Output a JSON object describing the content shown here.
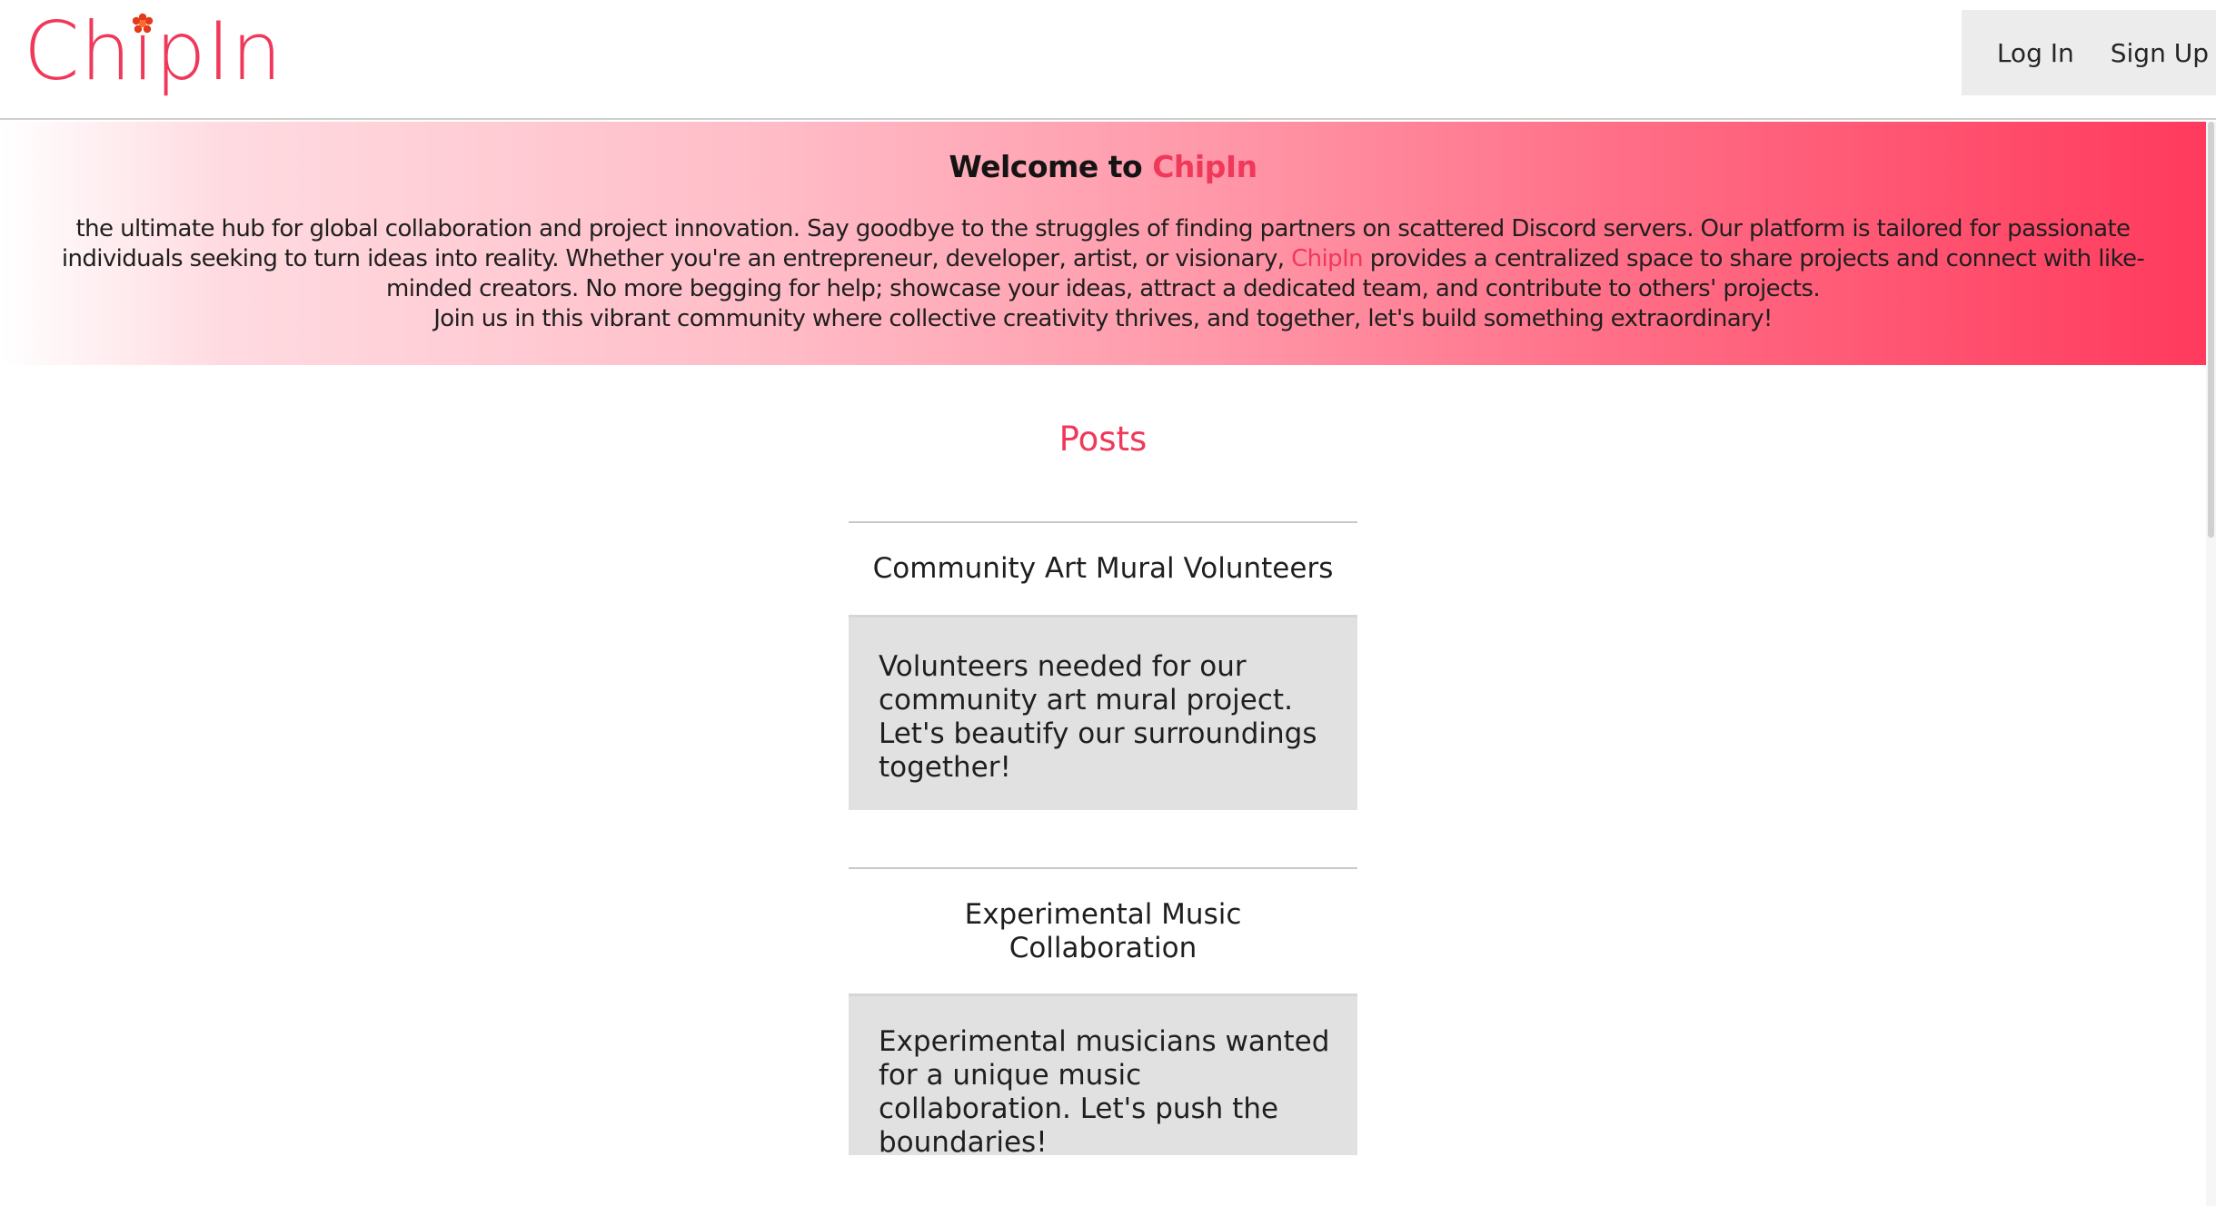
{
  "header": {
    "logo_text": "ChipIn",
    "login_label": "Log In",
    "signup_label": "Sign Up"
  },
  "hero": {
    "title_prefix": "Welcome to",
    "title_brand": "ChipIn",
    "text_1": "the ultimate hub for global collaboration and project innovation. Say goodbye to the struggles of finding partners on scattered Discord servers. Our platform is tailored for passionate individuals seeking to turn ideas into reality. Whether you're an entrepreneur, developer, artist, or visionary,",
    "text_brand": "ChipIn",
    "text_2": "provides a centralized space to share projects and connect with like-minded creators. No more begging for help; showcase your ideas, attract a dedicated team, and contribute to others' projects.",
    "text_3": "Join us in this vibrant community where collective creativity thrives, and together, let's build something extraordinary!"
  },
  "posts": {
    "heading": "Posts",
    "items": [
      {
        "title": "Community Art Mural Volunteers",
        "body": "Volunteers needed for our community art mural project. Let's beautify our surroundings together!"
      },
      {
        "title": "Experimental Music Collaboration",
        "body": "Experimental musicians wanted for a unique music collaboration. Let's push the boundaries!"
      }
    ]
  },
  "colors": {
    "brand": "#f0385a",
    "gradient_end": "#ff3a5d",
    "card_background": "#e1e1e1",
    "nav_background": "#ececec"
  },
  "icons": {
    "logo_mark": "flower-icon"
  }
}
